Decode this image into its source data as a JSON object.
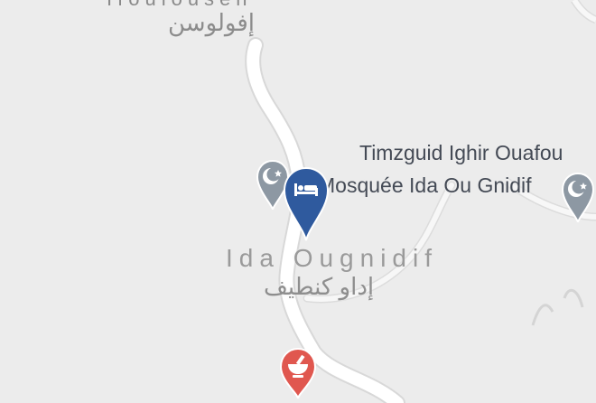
{
  "map": {
    "labels": {
      "town_top_latin": "Ifoulousen",
      "town_top_arabic": "إفولوسن",
      "poi_timzguid": "Timzguid Ighir Ouafou",
      "poi_mosque": "Mosquée Ida Ou Gnidif",
      "place_latin": "Ida Ougnidif",
      "place_arabic": "إداو كنطيف"
    },
    "pins": {
      "hotel": {
        "icon": "bed-icon",
        "color": "#2f5a9e"
      },
      "mosque_left": {
        "icon": "crescent-star-icon",
        "color": "#8d98a3"
      },
      "mosque_right": {
        "icon": "crescent-star-icon",
        "color": "#8d98a3"
      },
      "pharmacy": {
        "icon": "mortar-pestle-icon",
        "color": "#e0574f"
      }
    },
    "colors": {
      "background": "#ececec",
      "road": "#ffffff",
      "road_edge": "#d6d6d6"
    }
  }
}
